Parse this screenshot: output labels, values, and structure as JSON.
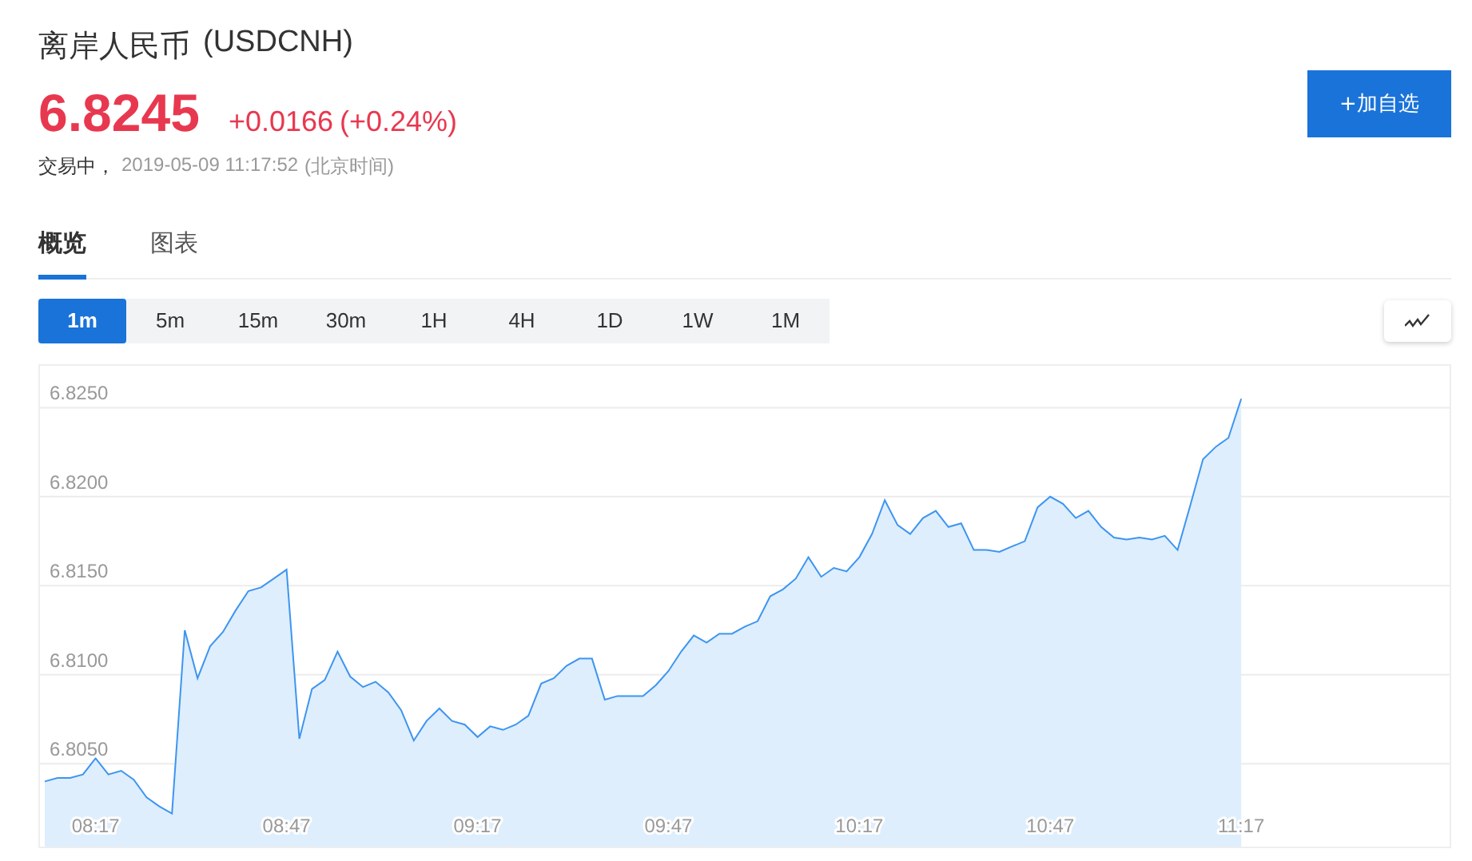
{
  "header": {
    "name": "离岸人民币",
    "symbol": "(USDCNH)",
    "price": "6.8245",
    "change": "+0.0166",
    "change_percent": "(+0.24%)",
    "status": "交易中，",
    "timestamp": "2019-05-09 11:17:52",
    "timezone": "(北京时间)"
  },
  "watchlist_button": {
    "label": "+加自选"
  },
  "tabs": [
    {
      "label": "概览",
      "selected": true
    },
    {
      "label": "图表",
      "selected": false
    }
  ],
  "intervals": [
    {
      "label": "1m",
      "selected": true
    },
    {
      "label": "5m",
      "selected": false
    },
    {
      "label": "15m",
      "selected": false
    },
    {
      "label": "30m",
      "selected": false
    },
    {
      "label": "1H",
      "selected": false
    },
    {
      "label": "4H",
      "selected": false
    },
    {
      "label": "1D",
      "selected": false
    },
    {
      "label": "1W",
      "selected": false
    },
    {
      "label": "1M",
      "selected": false
    }
  ],
  "chart": {
    "chart_data": {
      "type": "area",
      "grid": true,
      "categories": [
        null,
        null,
        null,
        null,
        "08:17",
        null,
        null,
        null,
        null,
        null,
        null,
        null,
        null,
        null,
        null,
        null,
        null,
        null,
        null,
        "08:47",
        null,
        null,
        null,
        null,
        null,
        null,
        null,
        null,
        null,
        null,
        null,
        null,
        null,
        null,
        "09:17",
        null,
        null,
        null,
        null,
        null,
        null,
        null,
        null,
        null,
        null,
        null,
        null,
        null,
        null,
        "09:47",
        null,
        null,
        null,
        null,
        null,
        null,
        null,
        null,
        null,
        null,
        null,
        null,
        null,
        null,
        "10:17",
        null,
        null,
        null,
        null,
        null,
        null,
        null,
        null,
        null,
        null,
        null,
        null,
        null,
        null,
        "10:47",
        null,
        null,
        null,
        null,
        null,
        null,
        null,
        null,
        null,
        null,
        null,
        null,
        null,
        null,
        "11:17",
        null,
        null,
        null,
        null,
        null,
        null,
        null,
        null,
        null,
        null,
        null,
        null,
        null,
        null,
        null,
        null
      ],
      "series": [
        {
          "color": "#3d95f0",
          "values": [
            6.804,
            6.8042,
            6.8042,
            6.8044,
            6.8053,
            6.8044,
            6.8046,
            6.8041,
            6.8031,
            6.8026,
            6.8022,
            6.8125,
            6.8098,
            6.8116,
            6.8124,
            6.8136,
            6.8147,
            6.8149,
            6.8154,
            6.8159,
            6.8064,
            6.8092,
            6.8097,
            6.8113,
            6.8099,
            6.8093,
            6.8096,
            6.809,
            6.808,
            6.8063,
            6.8074,
            6.8081,
            6.8074,
            6.8072,
            6.8065,
            6.8071,
            6.8069,
            6.8072,
            6.8077,
            6.8095,
            6.8098,
            6.8105,
            6.8109,
            6.8109,
            6.8086,
            6.8088,
            6.8088,
            6.8088,
            6.8094,
            6.8102,
            6.8113,
            6.8122,
            6.8118,
            6.8123,
            6.8123,
            6.8127,
            6.813,
            6.8144,
            6.8148,
            6.8154,
            6.8166,
            6.8155,
            6.816,
            6.8158,
            6.8166,
            6.8179,
            6.8198,
            6.8184,
            6.8179,
            6.8188,
            6.8192,
            6.8183,
            6.8185,
            6.817,
            6.817,
            6.8169,
            6.8172,
            6.8175,
            6.8194,
            6.82,
            6.8196,
            6.8188,
            6.8192,
            6.8183,
            6.8177,
            6.8176,
            6.8177,
            6.8176,
            6.8178,
            6.817,
            6.8195,
            6.8221,
            6.8228,
            6.8233,
            6.8255,
            null,
            null,
            null,
            null,
            null,
            null,
            null,
            null,
            null,
            null,
            null,
            null,
            null,
            null,
            null,
            null
          ]
        }
      ],
      "ylim": [
        6.80034,
        6.82735
      ],
      "yticks": [
        {
          "value": 6.805,
          "label": "6.8050"
        },
        {
          "value": 6.81,
          "label": "6.8100"
        },
        {
          "value": 6.815,
          "label": "6.8150"
        },
        {
          "value": 6.82,
          "label": "6.8200"
        },
        {
          "value": 6.825,
          "label": "6.8250"
        }
      ]
    }
  }
}
